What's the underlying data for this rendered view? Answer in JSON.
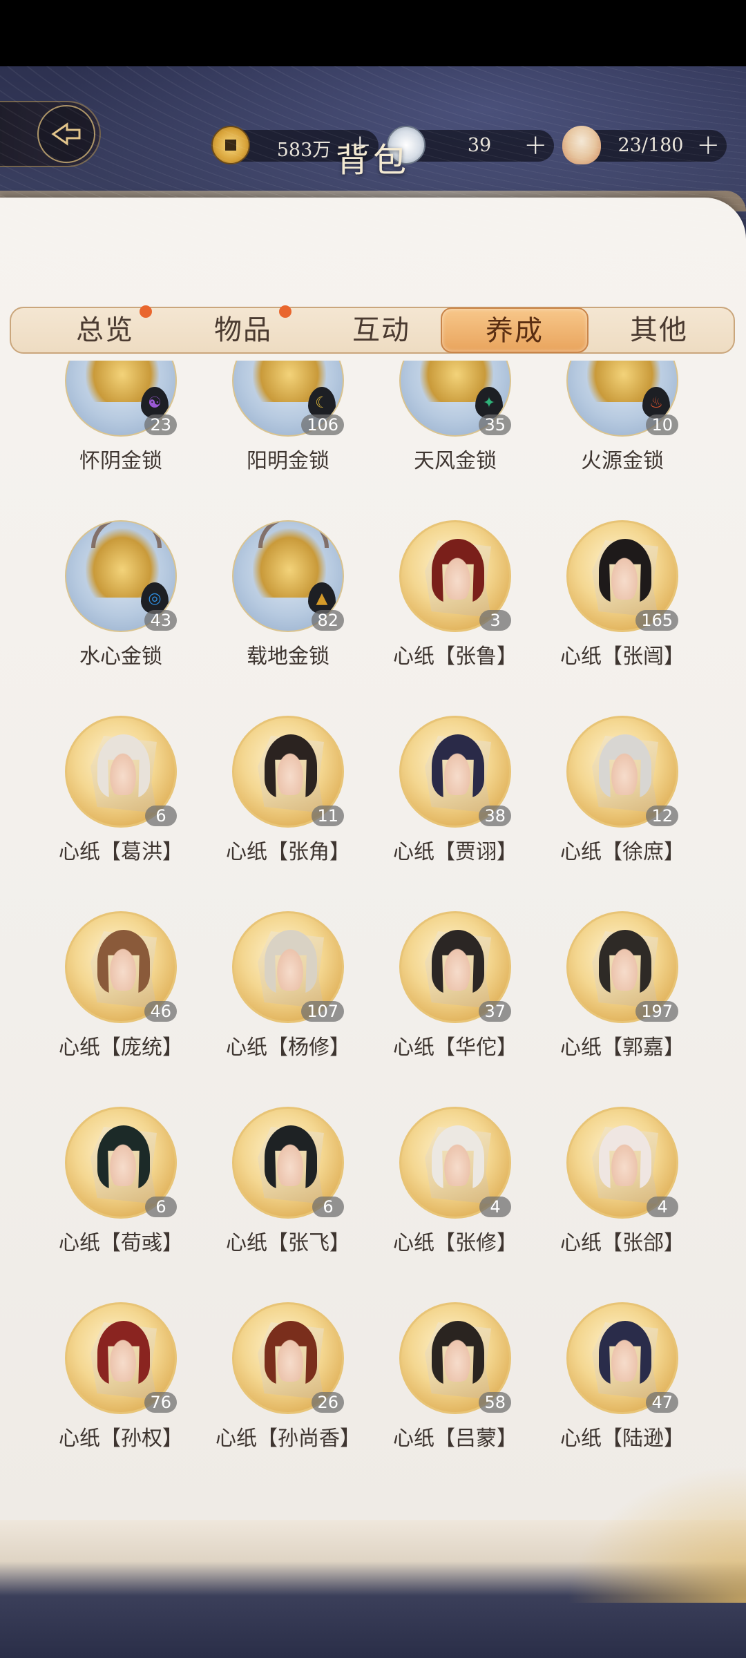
{
  "header": {
    "title": "背包"
  },
  "currencies": [
    {
      "icon": "coin-icon",
      "value": "583万",
      "plus": "+"
    },
    {
      "icon": "silver-coin-icon",
      "value": "39",
      "plus": "+"
    },
    {
      "icon": "food-bowl-icon",
      "value": "23/180",
      "plus": "+"
    }
  ],
  "tabs": [
    {
      "label": "总览",
      "badge": true
    },
    {
      "label": "物品",
      "badge": true
    },
    {
      "label": "互动",
      "badge": false
    },
    {
      "label": "养成",
      "badge": false,
      "active": true
    },
    {
      "label": "其他",
      "badge": false
    }
  ],
  "items": [
    {
      "name": "怀阴金锁",
      "count": "23",
      "kind": "lock",
      "element": "☯",
      "elementColor": "#9b59d6"
    },
    {
      "name": "阳明金锁",
      "count": "106",
      "kind": "lock",
      "element": "☾",
      "elementColor": "#e0b83a"
    },
    {
      "name": "天风金锁",
      "count": "35",
      "kind": "lock",
      "element": "✦",
      "elementColor": "#2fb37a"
    },
    {
      "name": "火源金锁",
      "count": "10",
      "kind": "lock",
      "element": "♨",
      "elementColor": "#e0542e"
    },
    {
      "name": "水心金锁",
      "count": "43",
      "kind": "lock",
      "element": "◎",
      "elementColor": "#2e8ee0"
    },
    {
      "name": "载地金锁",
      "count": "82",
      "kind": "lock",
      "element": "▲",
      "elementColor": "#d49a2a"
    },
    {
      "name": "心纸【张鲁】",
      "count": "3",
      "kind": "paper",
      "hair": "#7a1f1a"
    },
    {
      "name": "心纸【张闿】",
      "count": "165",
      "kind": "paper",
      "hair": "#1e1a1a"
    },
    {
      "name": "心纸【葛洪】",
      "count": "6",
      "kind": "paper",
      "hair": "#e8e2da"
    },
    {
      "name": "心纸【张角】",
      "count": "11",
      "kind": "paper",
      "hair": "#2b2320"
    },
    {
      "name": "心纸【贾诩】",
      "count": "38",
      "kind": "paper",
      "hair": "#2a2a48"
    },
    {
      "name": "心纸【徐庶】",
      "count": "12",
      "kind": "paper",
      "hair": "#d8d6d2"
    },
    {
      "name": "心纸【庞统】",
      "count": "46",
      "kind": "paper",
      "hair": "#8a5a3a"
    },
    {
      "name": "心纸【杨修】",
      "count": "107",
      "kind": "paper",
      "hair": "#d9d2c4"
    },
    {
      "name": "心纸【华佗】",
      "count": "37",
      "kind": "paper",
      "hair": "#2b2624"
    },
    {
      "name": "心纸【郭嘉】",
      "count": "197",
      "kind": "paper",
      "hair": "#2e2a26"
    },
    {
      "name": "心纸【荀彧】",
      "count": "6",
      "kind": "paper",
      "hair": "#1c2a28"
    },
    {
      "name": "心纸【张飞】",
      "count": "6",
      "kind": "paper",
      "hair": "#1e2224"
    },
    {
      "name": "心纸【张修】",
      "count": "4",
      "kind": "paper",
      "hair": "#ece8e2"
    },
    {
      "name": "心纸【张郃】",
      "count": "4",
      "kind": "paper",
      "hair": "#efe6e2"
    },
    {
      "name": "心纸【孙权】",
      "count": "76",
      "kind": "paper",
      "hair": "#8a2420"
    },
    {
      "name": "心纸【孙尚香】",
      "count": "26",
      "kind": "paper",
      "hair": "#7a2e1c"
    },
    {
      "name": "心纸【吕蒙】",
      "count": "58",
      "kind": "paper",
      "hair": "#2a2420"
    },
    {
      "name": "心纸【陆逊】",
      "count": "47",
      "kind": "paper",
      "hair": "#2a2c4a"
    }
  ]
}
